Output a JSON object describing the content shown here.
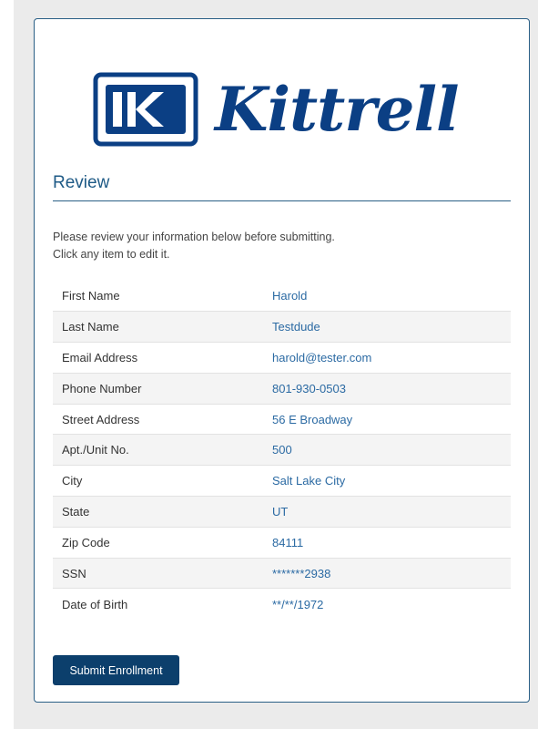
{
  "brand": {
    "logo_text": "Kittrell",
    "color": "#0b3f84"
  },
  "review": {
    "title": "Review",
    "intro_line1": "Please review your information below before submitting.",
    "intro_line2": "Click any item to edit it.",
    "rows": [
      {
        "label": "First Name",
        "value": "Harold"
      },
      {
        "label": "Last Name",
        "value": "Testdude"
      },
      {
        "label": "Email Address",
        "value": "harold@tester.com"
      },
      {
        "label": "Phone Number",
        "value": "801-930-0503"
      },
      {
        "label": "Street Address",
        "value": "56 E Broadway"
      },
      {
        "label": "Apt./Unit No.",
        "value": "500"
      },
      {
        "label": "City",
        "value": "Salt Lake City"
      },
      {
        "label": "State",
        "value": "UT"
      },
      {
        "label": "Zip Code",
        "value": "84111"
      },
      {
        "label": "SSN",
        "value": "*******2938"
      },
      {
        "label": "Date of Birth",
        "value": "**/**/1972"
      }
    ]
  },
  "actions": {
    "submit_label": "Submit Enrollment"
  },
  "colors": {
    "accent": "#0c3f6c",
    "link": "#2b6aa3",
    "border": "#2a5f86"
  }
}
